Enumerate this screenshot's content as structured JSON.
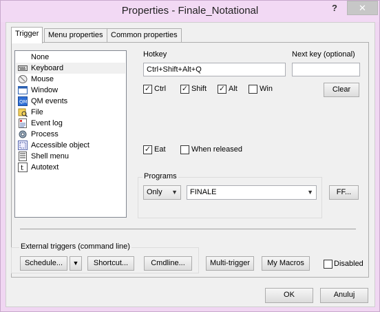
{
  "window": {
    "title": "Properties - Finale_Notational",
    "help_glyph": "?",
    "close_glyph": "✕"
  },
  "tabs": [
    {
      "label": "Trigger",
      "active": true
    },
    {
      "label": "Menu properties",
      "active": false
    },
    {
      "label": "Common properties",
      "active": false
    }
  ],
  "trigger_list": [
    {
      "label": "None",
      "icon": "none"
    },
    {
      "label": "Keyboard",
      "icon": "keyboard-icon",
      "selected": true
    },
    {
      "label": "Mouse",
      "icon": "mouse-icon"
    },
    {
      "label": "Window",
      "icon": "window-icon"
    },
    {
      "label": "QM events",
      "icon": "qm-events-icon"
    },
    {
      "label": "File",
      "icon": "file-search-icon"
    },
    {
      "label": "Event log",
      "icon": "event-log-icon"
    },
    {
      "label": "Process",
      "icon": "process-gear-icon"
    },
    {
      "label": "Accessible object",
      "icon": "accessible-object-icon"
    },
    {
      "label": "Shell menu",
      "icon": "shell-menu-icon"
    },
    {
      "label": "Autotext",
      "icon": "autotext-icon"
    }
  ],
  "hotkey": {
    "label": "Hotkey",
    "value": "Ctrl+Shift+Alt+Q",
    "next_key_label": "Next key (optional)",
    "next_key_value": "",
    "clear_label": "Clear"
  },
  "modifiers": [
    {
      "label": "Ctrl",
      "checked": true
    },
    {
      "label": "Shift",
      "checked": true
    },
    {
      "label": "Alt",
      "checked": true
    },
    {
      "label": "Win",
      "checked": false
    }
  ],
  "options": {
    "eat_label": "Eat",
    "eat_checked": true,
    "when_released_label": "When released",
    "when_released_checked": false
  },
  "programs": {
    "label": "Programs",
    "mode_value": "Only",
    "program_value": "FINALE",
    "browse_label": "FF..."
  },
  "external": {
    "label": "External triggers (command line)",
    "schedule_label": "Schedule...",
    "shortcut_label": "Shortcut...",
    "cmdline_label": "Cmdline..."
  },
  "bottom": {
    "multi_trigger_label": "Multi-trigger",
    "my_macros_label": "My Macros",
    "disabled_label": "Disabled",
    "disabled_checked": false,
    "ok_label": "OK",
    "cancel_label": "Anuluj"
  },
  "checkmark_glyph": "✓",
  "dropdown_glyph": "▼"
}
